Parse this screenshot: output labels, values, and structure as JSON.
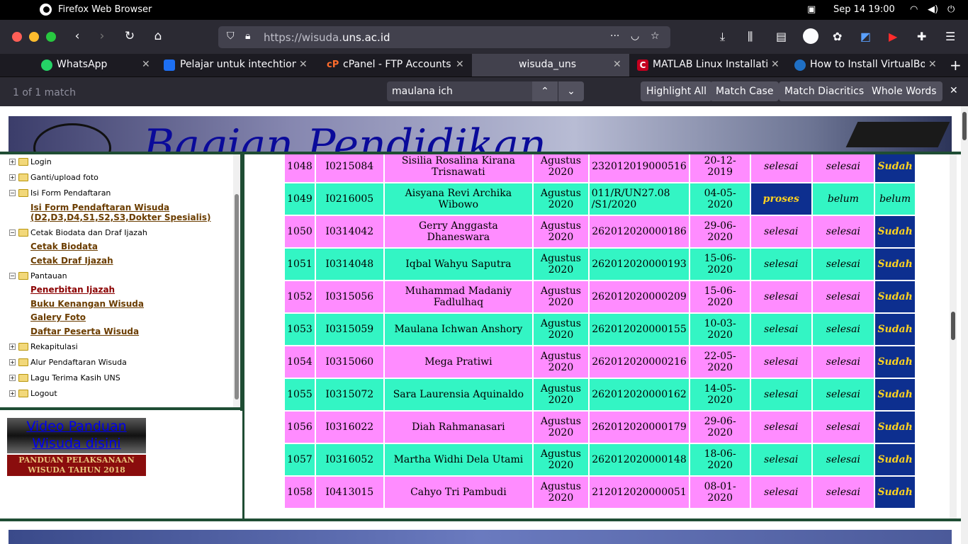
{
  "system": {
    "app_name": "Firefox Web Browser",
    "datetime": "Sep 14  19:00"
  },
  "browser": {
    "url_prefix": "https://wisuda.",
    "url_domain": "uns.ac.id",
    "tabs": [
      {
        "label": "WhatsApp",
        "color": "#25d366"
      },
      {
        "label": "Pelajar untuk intechtion.c",
        "color": "#1d6ff2"
      },
      {
        "label": "cPanel - FTP Accounts",
        "color": "#ff6c2c"
      },
      {
        "label": "wisuda_uns",
        "color": "#42414d"
      },
      {
        "label": "MATLAB Linux Installatio",
        "color": "#c4001f"
      },
      {
        "label": "How to Install VirtualBox",
        "color": "#1f6fc4"
      }
    ]
  },
  "findbar": {
    "matches": "1 of 1 match",
    "query": "maulana ich",
    "highlight_all": "Highlight All",
    "match_case": "Match Case",
    "match_diacritics": "Match Diacritics",
    "whole_words": "Whole Words"
  },
  "banner": {
    "title": "Bagian Pendidikan"
  },
  "menu": {
    "login": "Login",
    "ganti_foto": "Ganti/upload foto",
    "isi_form": "Isi Form Pendaftaran",
    "isi_form_link_1": "Isi Form Pendaftaran Wisuda",
    "isi_form_link_2": "(D2,D3,D4,S1,S2,S3,Dokter Spesialis)",
    "cetak": "Cetak Biodata dan Draf Ijazah",
    "cetak_biodata": "Cetak Biodata",
    "cetak_draf": "Cetak Draf Ijazah",
    "pantauan": "Pantauan",
    "penerbitan": "Penerbitan Ijazah",
    "buku": "Buku Kenangan Wisuda",
    "galery": "Galery Foto",
    "daftar": "Daftar Peserta Wisuda",
    "rekapitulasi": "Rekapitulasi",
    "alur": "Alur Pendaftaran Wisuda",
    "lagu": "Lagu Terima Kasih UNS",
    "logout": "Logout"
  },
  "sidebar_buttons": {
    "video_1": "Video Panduan",
    "video_2": "Wisuda disini",
    "panduan_1": "PANDUAN PELAKSANAAN",
    "panduan_2": "WISUDA TAHUN 2018"
  },
  "table": {
    "rows": [
      {
        "no": "1048",
        "nim": "I0215084",
        "nama": "Sisilia Rosalina Kirana Trisnawati",
        "periode": "Agustus 2020",
        "ijazah": "232012019000516",
        "tanggal": "20-12-2019",
        "s1": "selesai",
        "s2": "selesai",
        "status": "Sudah"
      },
      {
        "no": "1049",
        "nim": "I0216005",
        "nama": "Aisyana Revi Archika Wibowo",
        "periode": "Agustus 2020",
        "ijazah": "011/R/UN27.08 /S1/2020",
        "tanggal": "04-05-2020",
        "s1": "proses",
        "s2": "belum",
        "status": "belum"
      },
      {
        "no": "1050",
        "nim": "I0314042",
        "nama": "Gerry Anggasta Dhaneswara",
        "periode": "Agustus 2020",
        "ijazah": "262012020000186",
        "tanggal": "29-06-2020",
        "s1": "selesai",
        "s2": "selesai",
        "status": "Sudah"
      },
      {
        "no": "1051",
        "nim": "I0314048",
        "nama": "Iqbal Wahyu Saputra",
        "periode": "Agustus 2020",
        "ijazah": "262012020000193",
        "tanggal": "15-06-2020",
        "s1": "selesai",
        "s2": "selesai",
        "status": "Sudah"
      },
      {
        "no": "1052",
        "nim": "I0315056",
        "nama": "Muhammad Madaniy Fadlulhaq",
        "periode": "Agustus 2020",
        "ijazah": "262012020000209",
        "tanggal": "15-06-2020",
        "s1": "selesai",
        "s2": "selesai",
        "status": "Sudah"
      },
      {
        "no": "1053",
        "nim": "I0315059",
        "nama": "Maulana Ichwan Anshory",
        "periode": "Agustus 2020",
        "ijazah": "262012020000155",
        "tanggal": "10-03-2020",
        "s1": "selesai",
        "s2": "selesai",
        "status": "Sudah"
      },
      {
        "no": "1054",
        "nim": "I0315060",
        "nama": "Mega Pratiwi",
        "periode": "Agustus 2020",
        "ijazah": "262012020000216",
        "tanggal": "22-05-2020",
        "s1": "selesai",
        "s2": "selesai",
        "status": "Sudah"
      },
      {
        "no": "1055",
        "nim": "I0315072",
        "nama": "Sara Laurensia Aquinaldo",
        "periode": "Agustus 2020",
        "ijazah": "262012020000162",
        "tanggal": "14-05-2020",
        "s1": "selesai",
        "s2": "selesai",
        "status": "Sudah"
      },
      {
        "no": "1056",
        "nim": "I0316022",
        "nama": "Diah Rahmanasari",
        "periode": "Agustus 2020",
        "ijazah": "262012020000179",
        "tanggal": "29-06-2020",
        "s1": "selesai",
        "s2": "selesai",
        "status": "Sudah"
      },
      {
        "no": "1057",
        "nim": "I0316052",
        "nama": "Martha Widhi Dela Utami",
        "periode": "Agustus 2020",
        "ijazah": "262012020000148",
        "tanggal": "18-06-2020",
        "s1": "selesai",
        "s2": "selesai",
        "status": "Sudah"
      },
      {
        "no": "1058",
        "nim": "I0413015",
        "nama": "Cahyo Tri Pambudi",
        "periode": "Agustus 2020",
        "ijazah": "212012020000051",
        "tanggal": "08-01-2020",
        "s1": "selesai",
        "s2": "selesai",
        "status": "Sudah"
      }
    ]
  }
}
